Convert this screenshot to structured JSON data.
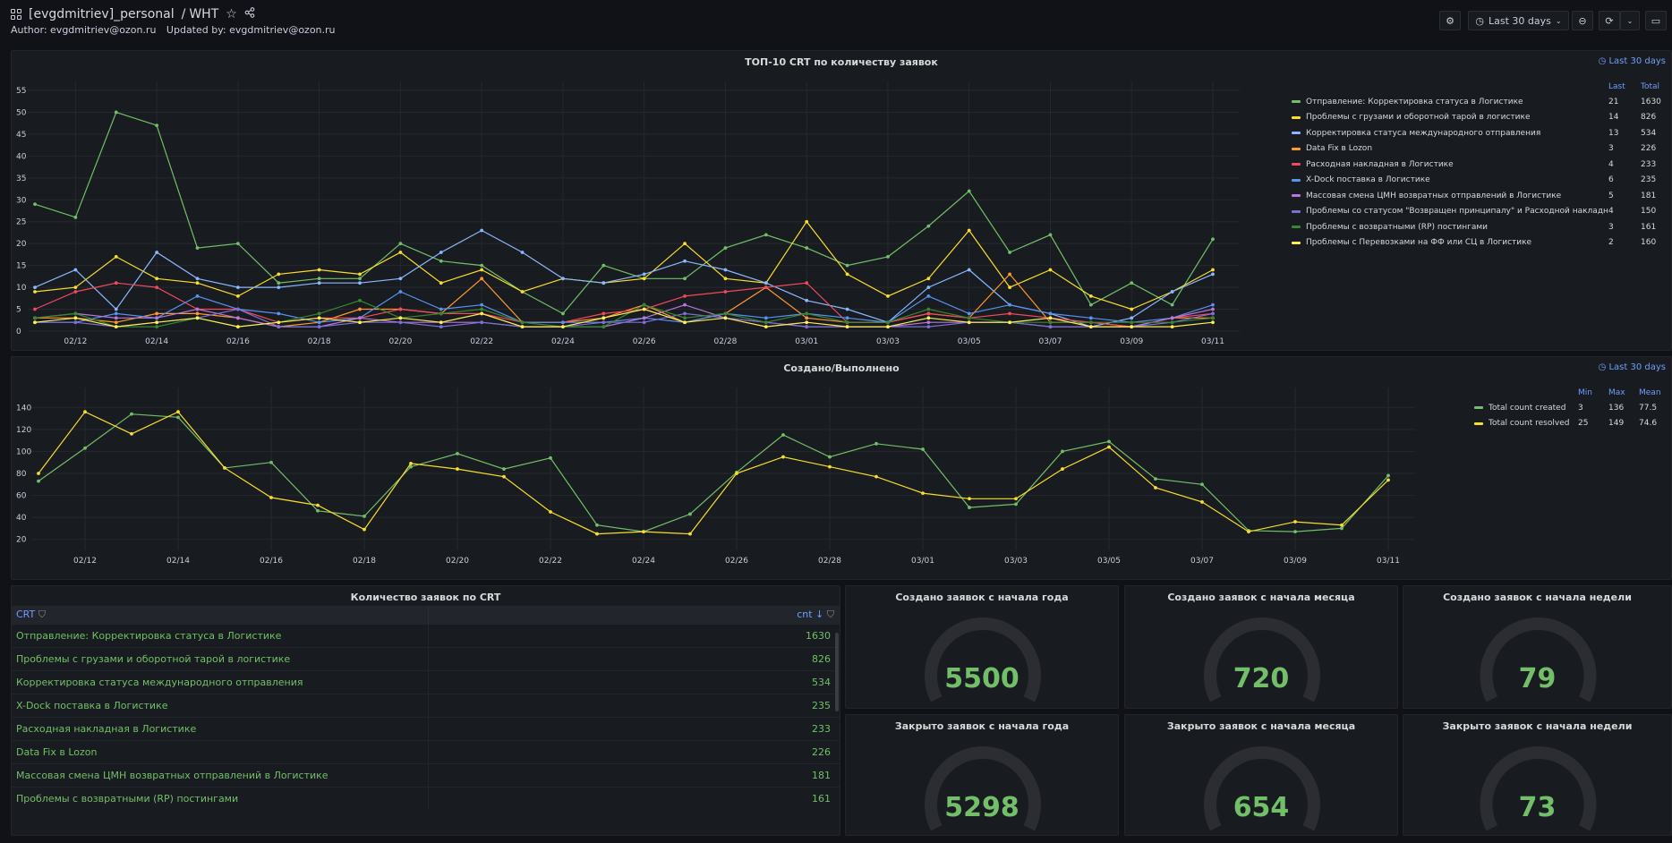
{
  "header": {
    "folder": "[evgdmitriev]_personal",
    "separator": "/",
    "dashboard": "WHT",
    "author": "Author: evgdmitriev@ozon.ru",
    "updated": "Updated by: evgdmitriev@ozon.ru",
    "time_range": "Last 30 days"
  },
  "panel_top10": {
    "title": "ТОП-10 CRT по количеству заявок",
    "time_badge": "Last 30 days",
    "legend_headers": [
      "Last",
      "Total"
    ]
  },
  "panel_created": {
    "title": "Создано/Выполнено",
    "time_badge": "Last 30 days",
    "legend_headers": [
      "Min",
      "Max",
      "Mean"
    ]
  },
  "panel_table": {
    "title": "Количество заявок по CRT",
    "col_crt": "CRT",
    "col_cnt": "cnt",
    "rows": [
      {
        "crt": "Отправление: Корректировка статуса в Логистике",
        "cnt": "1630"
      },
      {
        "crt": "Проблемы с грузами и оборотной тарой в логистике",
        "cnt": "826"
      },
      {
        "crt": "Корректировка статуса международного отправления",
        "cnt": "534"
      },
      {
        "crt": "X-Dock поставка в Логистике",
        "cnt": "235"
      },
      {
        "crt": "Расходная накладная в Логистике",
        "cnt": "233"
      },
      {
        "crt": "Data Fix в Lozon",
        "cnt": "226"
      },
      {
        "crt": "Массовая смена ЦМН возвратных отправлений в Логистике",
        "cnt": "181"
      },
      {
        "crt": "Проблемы с возвратными (RP) постингами",
        "cnt": "161"
      }
    ]
  },
  "stats": [
    {
      "title": "Создано заявок с начала года",
      "value": "5500"
    },
    {
      "title": "Создано заявок с начала месяца",
      "value": "720"
    },
    {
      "title": "Создано заявок с начала недели",
      "value": "79"
    },
    {
      "title": "Закрыто заявок с начала года",
      "value": "5298"
    },
    {
      "title": "Закрыто заявок с начала месяца",
      "value": "654"
    },
    {
      "title": "Закрыто заявок с начала недели",
      "value": "73"
    }
  ],
  "chart_data": [
    {
      "type": "line",
      "title": "ТОП-10 CRT по количеству заявок",
      "x": [
        "02/11",
        "02/12",
        "02/13",
        "02/14",
        "02/15",
        "02/16",
        "02/17",
        "02/18",
        "02/19",
        "02/20",
        "02/21",
        "02/22",
        "02/23",
        "02/24",
        "02/25",
        "02/26",
        "02/27",
        "02/28",
        "02/29",
        "03/01",
        "03/02",
        "03/03",
        "03/04",
        "03/05",
        "03/06",
        "03/07",
        "03/08",
        "03/09",
        "03/10",
        "03/11"
      ],
      "x_ticks": [
        "02/12",
        "02/14",
        "02/16",
        "02/18",
        "02/20",
        "02/22",
        "02/24",
        "02/26",
        "02/28",
        "03/01",
        "03/03",
        "03/05",
        "03/07",
        "03/09",
        "03/11"
      ],
      "ylim": [
        0,
        55
      ],
      "y_ticks": [
        0,
        5,
        10,
        15,
        20,
        25,
        30,
        35,
        40,
        45,
        50,
        55
      ],
      "series": [
        {
          "name": "Отправление: Корректировка статуса в Логистике",
          "color": "#73bf69",
          "last": "21",
          "total": "1630",
          "values": [
            29,
            26,
            50,
            47,
            19,
            20,
            11,
            12,
            12,
            20,
            16,
            15,
            9,
            4,
            15,
            12,
            12,
            19,
            22,
            19,
            15,
            17,
            24,
            32,
            18,
            22,
            6,
            11,
            6,
            21
          ]
        },
        {
          "name": "Проблемы с грузами и оборотной тарой в логистике",
          "color": "#fade2a",
          "last": "14",
          "total": "826",
          "values": [
            9,
            10,
            17,
            12,
            11,
            8,
            13,
            14,
            13,
            18,
            11,
            14,
            9,
            12,
            11,
            12,
            20,
            12,
            11,
            25,
            13,
            8,
            12,
            23,
            10,
            14,
            8,
            5,
            9,
            14
          ]
        },
        {
          "name": "Корректировка статуса международного отправления",
          "color": "#8ab8ff",
          "last": "13",
          "total": "534",
          "values": [
            10,
            14,
            5,
            18,
            12,
            10,
            10,
            11,
            11,
            12,
            18,
            23,
            18,
            12,
            11,
            13,
            16,
            14,
            11,
            7,
            5,
            2,
            10,
            14,
            6,
            4,
            1,
            3,
            9,
            13
          ]
        },
        {
          "name": "Data Fix в Lozon",
          "color": "#ff9830",
          "last": "3",
          "total": "226",
          "values": [
            3,
            3,
            2,
            4,
            4,
            3,
            1,
            2,
            5,
            5,
            4,
            12,
            2,
            2,
            3,
            6,
            2,
            4,
            10,
            3,
            2,
            2,
            4,
            3,
            13,
            2,
            2,
            1,
            3,
            3
          ]
        },
        {
          "name": "Расходная накладная в Логистике",
          "color": "#f2495c",
          "last": "4",
          "total": "233",
          "values": [
            5,
            9,
            11,
            10,
            5,
            5,
            2,
            3,
            3,
            5,
            4,
            4,
            2,
            2,
            4,
            5,
            8,
            9,
            10,
            11,
            2,
            2,
            4,
            3,
            4,
            3,
            2,
            1,
            3,
            4
          ]
        },
        {
          "name": "X-Dock поставка в Логистике",
          "color": "#5794f2",
          "last": "6",
          "total": "235",
          "values": [
            2,
            2,
            4,
            3,
            8,
            5,
            4,
            2,
            3,
            9,
            5,
            6,
            2,
            2,
            2,
            3,
            2,
            4,
            3,
            4,
            3,
            2,
            8,
            4,
            6,
            4,
            3,
            2,
            3,
            6
          ]
        },
        {
          "name": "Массовая смена ЦМН возвратных отправлений в Логистике",
          "color": "#b877d9",
          "last": "5",
          "total": "181",
          "values": [
            3,
            4,
            3,
            3,
            5,
            3,
            1,
            1,
            3,
            2,
            2,
            2,
            1,
            1,
            1,
            3,
            6,
            3,
            2,
            1,
            1,
            1,
            2,
            2,
            2,
            1,
            1,
            1,
            3,
            5
          ]
        },
        {
          "name": "Проблемы со статусом \"Возвращен принципалу\" и Расходной накладной в",
          "color": "#7d6fd6",
          "last": "4",
          "total": "150",
          "values": [
            2,
            2,
            1,
            2,
            3,
            5,
            1,
            1,
            2,
            2,
            1,
            2,
            1,
            1,
            2,
            2,
            4,
            3,
            2,
            1,
            1,
            1,
            1,
            2,
            2,
            1,
            1,
            1,
            2,
            4
          ]
        },
        {
          "name": "Проблемы с возвратными (RP) постингами",
          "color": "#37872d",
          "last": "3",
          "total": "161",
          "values": [
            3,
            4,
            1,
            1,
            3,
            1,
            2,
            4,
            7,
            3,
            4,
            5,
            2,
            1,
            1,
            6,
            3,
            4,
            2,
            4,
            2,
            2,
            5,
            3,
            2,
            2,
            2,
            2,
            2,
            3
          ]
        },
        {
          "name": "Проблемы с Перевозками на ФФ или СЦ в Логистике",
          "color": "#ffee52",
          "last": "2",
          "total": "160",
          "values": [
            2,
            3,
            1,
            2,
            3,
            1,
            2,
            3,
            2,
            3,
            2,
            4,
            1,
            1,
            3,
            5,
            2,
            3,
            1,
            2,
            1,
            1,
            3,
            2,
            2,
            3,
            1,
            1,
            1,
            2
          ]
        }
      ]
    },
    {
      "type": "line",
      "title": "Создано/Выполнено",
      "x": [
        "02/11",
        "02/12",
        "02/13",
        "02/14",
        "02/15",
        "02/16",
        "02/17",
        "02/18",
        "02/19",
        "02/20",
        "02/21",
        "02/22",
        "02/23",
        "02/24",
        "02/25",
        "02/26",
        "02/27",
        "02/28",
        "02/29",
        "03/01",
        "03/02",
        "03/03",
        "03/04",
        "03/05",
        "03/06",
        "03/07",
        "03/08",
        "03/09",
        "03/10",
        "03/11"
      ],
      "x_ticks": [
        "02/12",
        "02/14",
        "02/16",
        "02/18",
        "02/20",
        "02/22",
        "02/24",
        "02/26",
        "02/28",
        "03/01",
        "03/03",
        "03/05",
        "03/07",
        "03/09",
        "03/11"
      ],
      "ylim": [
        10,
        150
      ],
      "y_ticks": [
        20,
        40,
        60,
        80,
        100,
        120,
        140
      ],
      "series": [
        {
          "name": "Total count created",
          "color": "#73bf69",
          "min": "3",
          "max": "136",
          "mean": "77.5",
          "values": [
            73,
            103,
            134,
            131,
            85,
            90,
            46,
            41,
            86,
            98,
            84,
            94,
            33,
            27,
            43,
            81,
            115,
            95,
            107,
            102,
            49,
            52,
            100,
            109,
            75,
            70,
            28,
            27,
            30,
            78
          ]
        },
        {
          "name": "Total count resolved",
          "color": "#fade2a",
          "min": "25",
          "max": "149",
          "mean": "74.6",
          "values": [
            80,
            136,
            116,
            136,
            85,
            58,
            51,
            29,
            89,
            84,
            77,
            45,
            25,
            27,
            25,
            80,
            95,
            86,
            77,
            62,
            57,
            57,
            84,
            104,
            67,
            54,
            27,
            36,
            33,
            74
          ]
        }
      ]
    }
  ]
}
